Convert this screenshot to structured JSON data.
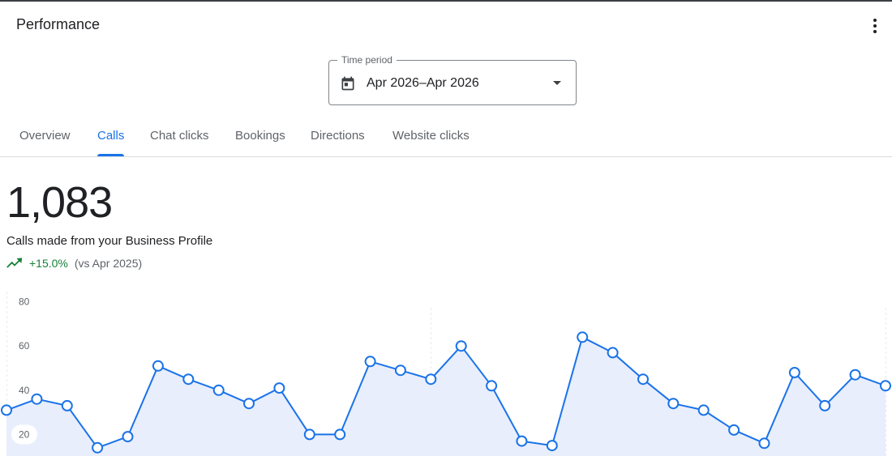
{
  "header": {
    "title": "Performance",
    "menu_icon": "more-vert-icon"
  },
  "time_period": {
    "label": "Time period",
    "value": "Apr 2026–Apr 2026",
    "icon": "calendar-icon"
  },
  "tabs": [
    {
      "label": "Overview",
      "active": false
    },
    {
      "label": "Calls",
      "active": true
    },
    {
      "label": "Chat clicks",
      "active": false
    },
    {
      "label": "Bookings",
      "active": false
    },
    {
      "label": "Directions",
      "active": false
    },
    {
      "label": "Website clicks",
      "active": false
    }
  ],
  "metric": {
    "value": "1,083",
    "description": "Calls made from your Business Profile",
    "change": "+15.0%",
    "comparison": "(vs Apr 2025)"
  },
  "colors": {
    "accent": "#1a73e8",
    "positive": "#188038",
    "fill": "#e8eefc",
    "text_secondary": "#5f6368"
  },
  "chart_data": {
    "type": "area",
    "y_ticks": [
      "80",
      "60",
      "40",
      "20"
    ],
    "ylim": [
      0,
      80
    ],
    "grid": false,
    "series": [
      {
        "values": [
          31,
          36,
          33,
          14,
          19,
          51,
          45,
          40,
          34,
          41,
          20,
          20,
          53,
          49,
          45,
          60,
          42,
          17,
          15,
          64,
          57,
          45,
          34,
          31,
          22,
          16,
          48,
          33,
          47,
          42
        ]
      }
    ]
  }
}
